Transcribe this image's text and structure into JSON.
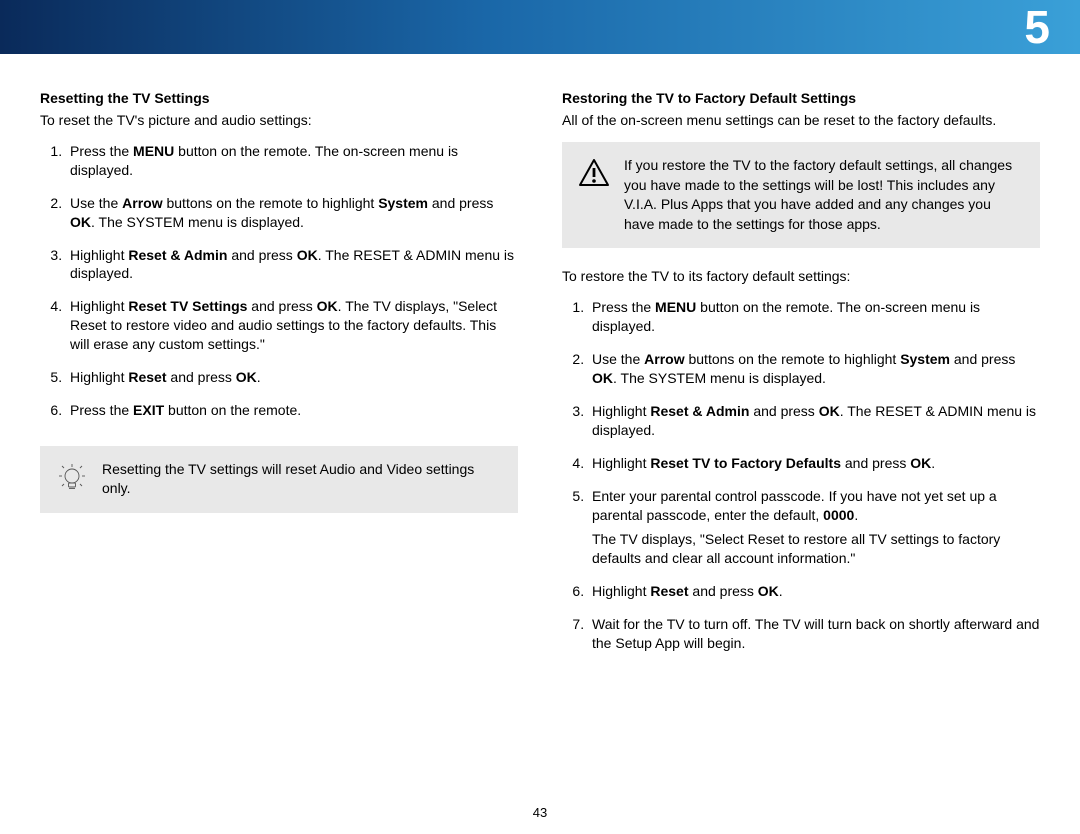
{
  "chapter": "5",
  "page_number": "43",
  "left": {
    "title": "Resetting the TV Settings",
    "intro": "To reset the TV's picture and audio settings:",
    "steps": [
      {
        "pre": "Press the ",
        "b1": "MENU",
        "post": " button on the remote. The on-screen menu is displayed."
      },
      {
        "pre": "Use the ",
        "b1": "Arrow",
        "mid1": " buttons on the remote to highlight ",
        "b2": "System",
        "mid2": " and press ",
        "b3": "OK",
        "post": ". The SYSTEM menu is displayed."
      },
      {
        "pre": "Highlight ",
        "b1": "Reset & Admin",
        "mid1": " and press ",
        "b2": "OK",
        "post": ". The RESET & ADMIN menu is displayed."
      },
      {
        "pre": "Highlight ",
        "b1": "Reset TV Settings",
        "mid1": " and press ",
        "b2": "OK",
        "post": ". The TV displays, \"Select Reset to restore video and audio settings to the factory defaults. This will erase any custom settings.\""
      },
      {
        "pre": "Highlight ",
        "b1": "Reset",
        "mid1": " and press ",
        "b2": "OK",
        "post": "."
      },
      {
        "pre": "Press the ",
        "b1": "EXIT",
        "post": " button on the remote."
      }
    ],
    "note": "Resetting the TV settings will reset Audio and Video settings only."
  },
  "right": {
    "title": "Restoring the TV to Factory Default Settings",
    "intro": "All of the on-screen menu settings can be reset to the factory defaults.",
    "warn": "If you restore the TV to the factory default settings, all changes you have made to the settings will be lost! This includes any V.I.A. Plus Apps that you have added and any changes you have made to the settings for those apps.",
    "intro2": "To restore the TV to its factory default settings:",
    "steps": [
      {
        "pre": "Press the ",
        "b1": "MENU",
        "post": " button on the remote. The on-screen menu is displayed."
      },
      {
        "pre": "Use the ",
        "b1": "Arrow",
        "mid1": " buttons on the remote to highlight ",
        "b2": "System",
        "mid2": " and press ",
        "b3": "OK",
        "post": ". The SYSTEM menu is displayed."
      },
      {
        "pre": "Highlight ",
        "b1": "Reset & Admin",
        "mid1": " and press ",
        "b2": "OK",
        "post": ". The RESET & ADMIN menu is displayed."
      },
      {
        "pre": "Highlight ",
        "b1": "Reset TV to Factory Defaults",
        "mid1": " and press ",
        "b2": "OK",
        "post": "."
      },
      {
        "pre": "Enter your parental control passcode. If you have not yet set up a parental passcode, enter the default, ",
        "b1": "0000",
        "post": ".",
        "sub": "The TV displays, \"Select Reset to restore all TV settings to factory defaults and clear all account information.\""
      },
      {
        "pre": "Highlight ",
        "b1": "Reset",
        "mid1": " and press ",
        "b2": "OK",
        "post": "."
      },
      {
        "pre": "Wait for the TV to turn off. The TV will turn back on shortly afterward and the Setup App will begin.",
        "post": ""
      }
    ]
  }
}
